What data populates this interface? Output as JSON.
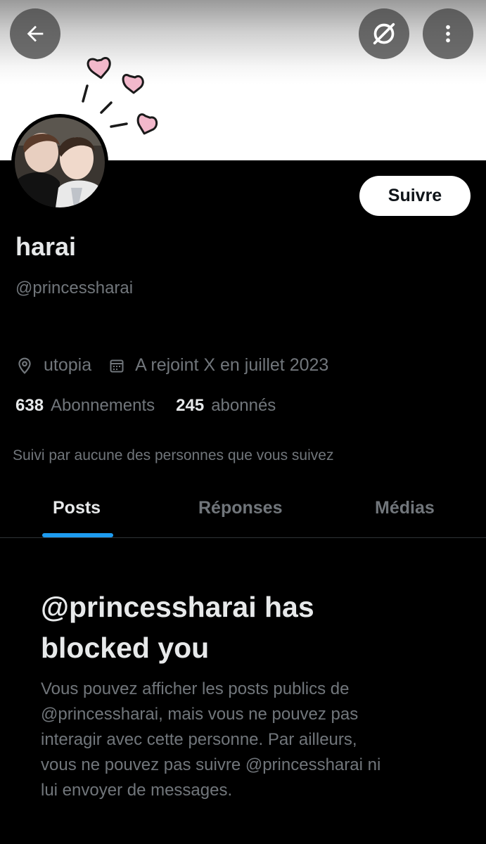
{
  "colors": {
    "background": "#000000",
    "text": "#e7e9ea",
    "secondary_text": "#71767b",
    "accent": "#1d9bf0",
    "follow_button": "#ffffff"
  },
  "header": {
    "back_icon": "arrow-left-icon",
    "unfollow_icon": "slashed-circle-icon",
    "more_icon": "vertical-dots-icon"
  },
  "profile": {
    "display_name": "harai",
    "handle": "@princessharai",
    "follow_label": "Suivre",
    "location": "utopia",
    "location_icon": "map-pin-icon",
    "joined": "A rejoint X en juillet 2023",
    "joined_icon": "calendar-icon",
    "following_count": "638",
    "following_label": "Abonnements",
    "followers_count": "245",
    "followers_label": "abonnés",
    "followed_by": "Suivi par aucune des personnes que vous suivez"
  },
  "tabs": [
    {
      "label": "Posts",
      "active": true
    },
    {
      "label": "Réponses",
      "active": false
    },
    {
      "label": "Médias",
      "active": false
    }
  ],
  "blocked": {
    "title_line1": "@princessharai has",
    "title_line2": "blocked you",
    "body_lines": [
      "Vous pouvez afficher les posts publics de",
      "@princessharai, mais vous ne pouvez pas",
      "interagir avec cette personne. Par ailleurs,",
      "vous ne pouvez pas suivre @princessharai ni",
      "lui envoyer de messages."
    ]
  }
}
